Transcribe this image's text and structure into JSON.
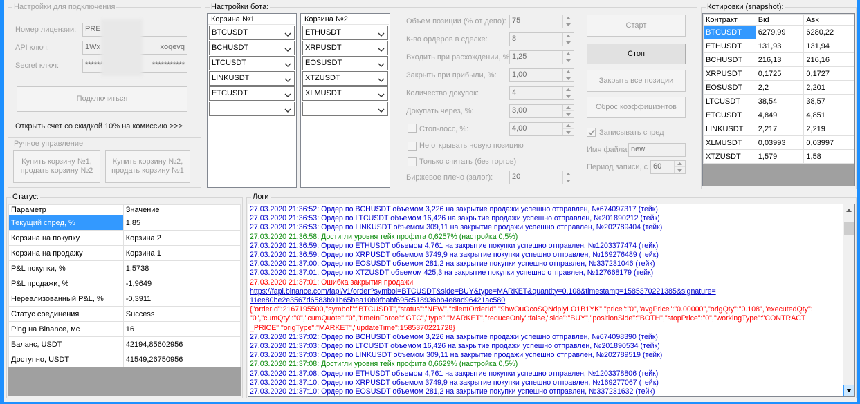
{
  "connection": {
    "legend": "Настройки для подключения",
    "license_label": "Номер лицензии:",
    "license_value": "PRE",
    "api_label": "API ключ:",
    "api_value": "1Wx",
    "api_value_tail": "xoqevq",
    "secret_label": "Secret ключ:",
    "secret_value": "************",
    "secret_value_tail": "***********",
    "connect_button": "Подключиться",
    "promo_link": "Открыть счет со скидкой 10% на комиссию >>>"
  },
  "manual": {
    "legend": "Ручное управление",
    "buy1_button": "Купить корзину №1, продать корзину №2",
    "buy2_button": "Купить корзину №2, продать корзину №1"
  },
  "bot": {
    "legend": "Настройки бота:",
    "basket1": {
      "header": "Корзина №1",
      "items": [
        "BTCUSDT",
        "BCHUSDT",
        "LTCUSDT",
        "LINKUSDT",
        "ETCUSDT",
        ""
      ]
    },
    "basket2": {
      "header": "Корзина №2",
      "items": [
        "ETHUSDT",
        "XRPUSDT",
        "EOSUSDT",
        "XTZUSDT",
        "XLMUSDT",
        ""
      ]
    },
    "params": [
      {
        "label": "Объем позиции (% от депо):",
        "value": "75"
      },
      {
        "label": "К-во ордеров в сделке:",
        "value": "8"
      },
      {
        "label": "Входить при расхождении, %:",
        "value": "1,25"
      },
      {
        "label": "Закрыть при прибыли, %:",
        "value": "1,00"
      },
      {
        "label": "Количество докупок:",
        "value": "4"
      },
      {
        "label": "Докупать через, %:",
        "value": "3,00"
      },
      {
        "label": "Стоп-лосс, %:",
        "value": "4,00"
      }
    ],
    "no_new_position": "Не открывать новую позицию",
    "only_count": "Только считать (без торгов)",
    "leverage_label": "Биржевое плечо (залог):",
    "leverage_value": "20",
    "start_button": "Старт",
    "stop_button": "Стоп",
    "close_all_button": "Закрыть все позиции",
    "reset_button": "Сброс коэффициэнтов",
    "record_spread": "Записывать спред",
    "file_label": "Имя файла:",
    "file_value": "new",
    "period_label": "Период записи, с",
    "period_value": "60"
  },
  "quotes": {
    "legend": "Котировки (snapshot):",
    "columns": [
      "Контракт",
      "Bid",
      "Ask"
    ],
    "rows": [
      [
        "BTCUSDT",
        "6279,99",
        "6280,22"
      ],
      [
        "ETHUSDT",
        "131,93",
        "131,94"
      ],
      [
        "BCHUSDT",
        "216,13",
        "216,16"
      ],
      [
        "XRPUSDT",
        "0,1725",
        "0,1727"
      ],
      [
        "EOSUSDT",
        "2,2",
        "2,201"
      ],
      [
        "LTCUSDT",
        "38,54",
        "38,57"
      ],
      [
        "ETCUSDT",
        "4,849",
        "4,851"
      ],
      [
        "LINKUSDT",
        "2,217",
        "2,219"
      ],
      [
        "XLMUSDT",
        "0,03993",
        "0,03997"
      ],
      [
        "XTZUSDT",
        "1,579",
        "1,58"
      ]
    ]
  },
  "status": {
    "legend": "Статус:",
    "columns": [
      "Параметр",
      "Значение"
    ],
    "rows": [
      [
        "Текущий спред, %",
        "1,85"
      ],
      [
        "Корзина на покупку",
        "Корзина 2"
      ],
      [
        "Корзина на продажу",
        "Корзина 1"
      ],
      [
        "P&L покупки, %",
        "1,5738"
      ],
      [
        "P&L продажи, %",
        "-1,9649"
      ],
      [
        "Нереализованный P&L, %",
        "-0,3911"
      ],
      [
        "Статус соединения",
        "Success"
      ],
      [
        "Ping на Binance, мс",
        "16"
      ],
      [
        "Баланс, USDT",
        "42194,85602956"
      ],
      [
        "Доступно, USDT",
        "41549,26750956"
      ]
    ]
  },
  "logs": {
    "legend": "Логи",
    "lines": [
      {
        "color": "blue",
        "text": "27.03.2020 21:36:52: Ордер по BCHUSDT объемом 3,226 на закрытие продажи успешно отправлен, №674097317 (тейк)"
      },
      {
        "color": "blue",
        "text": "27.03.2020 21:36:53: Ордер по LTCUSDT объемом 16,426 на закрытие продажи успешно отправлен, №201890212 (тейк)"
      },
      {
        "color": "blue",
        "text": "27.03.2020 21:36:53: Ордер по LINKUSDT объемом 309,11 на закрытие продажи успешно отправлен, №202789404 (тейк)"
      },
      {
        "color": "green",
        "text": "27.03.2020 21:36:58: Достигли уровня тейк профита 0,6257% (настройка 0,5%)"
      },
      {
        "color": "blue",
        "text": "27.03.2020 21:36:59: Ордер по ETHUSDT объемом 4,761 на закрытие покупки успешно отправлен, №1203377474 (тейк)"
      },
      {
        "color": "blue",
        "text": "27.03.2020 21:36:59: Ордер по XRPUSDT объемом 3749,9 на закрытие покупки успешно отправлен, №169276489 (тейк)"
      },
      {
        "color": "blue",
        "text": "27.03.2020 21:37:00: Ордер по EOSUSDT объемом 281,2 на закрытие покупки успешно отправлен, №337231046 (тейк)"
      },
      {
        "color": "blue",
        "text": "27.03.2020 21:37:01: Ордер по XTZUSDT объемом 425,3 на закрытие покупки успешно отправлен, №127668179 (тейк)"
      },
      {
        "color": "red",
        "text": "27.03.2020 21:37:01: Ошибка закрытия продажи"
      },
      {
        "color": "link",
        "text": "https://fapi.binance.com/fapi/v1/order?symbol=BTCUSDT&side=BUY&type=MARKET&quantity=0.108&timestamp=1585370221385&signature="
      },
      {
        "color": "link",
        "text": "11ee80be2e3567d6583b91b65bea10b9fbabf695c518936bb4e8ad96421ac580"
      },
      {
        "color": "red",
        "text": "{\"orderId\":2167195500,\"symbol\":\"BTCUSDT\",\"status\":\"NEW\",\"clientOrderId\":\"9hwOuOcoSQNdplyLO1B1YK\",\"price\":\"0\",\"avgPrice\":\"0.00000\",\"origQty\":\"0.108\",\"executedQty\":"
      },
      {
        "color": "red",
        "text": "\"0\",\"cumQty\":\"0\",\"cumQuote\":\"0\",\"timeInForce\":\"GTC\",\"type\":\"MARKET\",\"reduceOnly\":false,\"side\":\"BUY\",\"positionSide\":\"BOTH\",\"stopPrice\":\"0\",\"workingType\":\"CONTRACT"
      },
      {
        "color": "red",
        "text": "_PRICE\",\"origType\":\"MARKET\",\"updateTime\":1585370221728}"
      },
      {
        "color": "blue",
        "text": "27.03.2020 21:37:02: Ордер по BCHUSDT объемом 3,226 на закрытие продажи успешно отправлен, №674098390 (тейк)"
      },
      {
        "color": "blue",
        "text": "27.03.2020 21:37:03: Ордер по LTCUSDT объемом 16,426 на закрытие продажи успешно отправлен, №201890534 (тейк)"
      },
      {
        "color": "blue",
        "text": "27.03.2020 21:37:03: Ордер по LINKUSDT объемом 309,11 на закрытие продажи успешно отправлен, №202789519 (тейк)"
      },
      {
        "color": "green",
        "text": "27.03.2020 21:37:08: Достигли уровня тейк профита 0,6629% (настройка 0,5%)"
      },
      {
        "color": "blue",
        "text": "27.03.2020 21:37:08: Ордер по ETHUSDT объемом 4,761 на закрытие покупки успешно отправлен, №1203378806 (тейк)"
      },
      {
        "color": "blue",
        "text": "27.03.2020 21:37:10: Ордер по XRPUSDT объемом 3749,9 на закрытие покупки успешно отправлен, №169277067 (тейк)"
      },
      {
        "color": "blue",
        "text": "27.03.2020 21:37:10: Ордер по EOSUSDT объемом 281,2 на закрытие покупки успешно отправлен, №337231632 (тейк)"
      }
    ]
  },
  "colors": {
    "window_frame": "#1e90ff",
    "selection": "#3399ff",
    "log_blue": "#0000cc",
    "log_green": "#0a8a0a",
    "log_red": "#ff0000"
  }
}
